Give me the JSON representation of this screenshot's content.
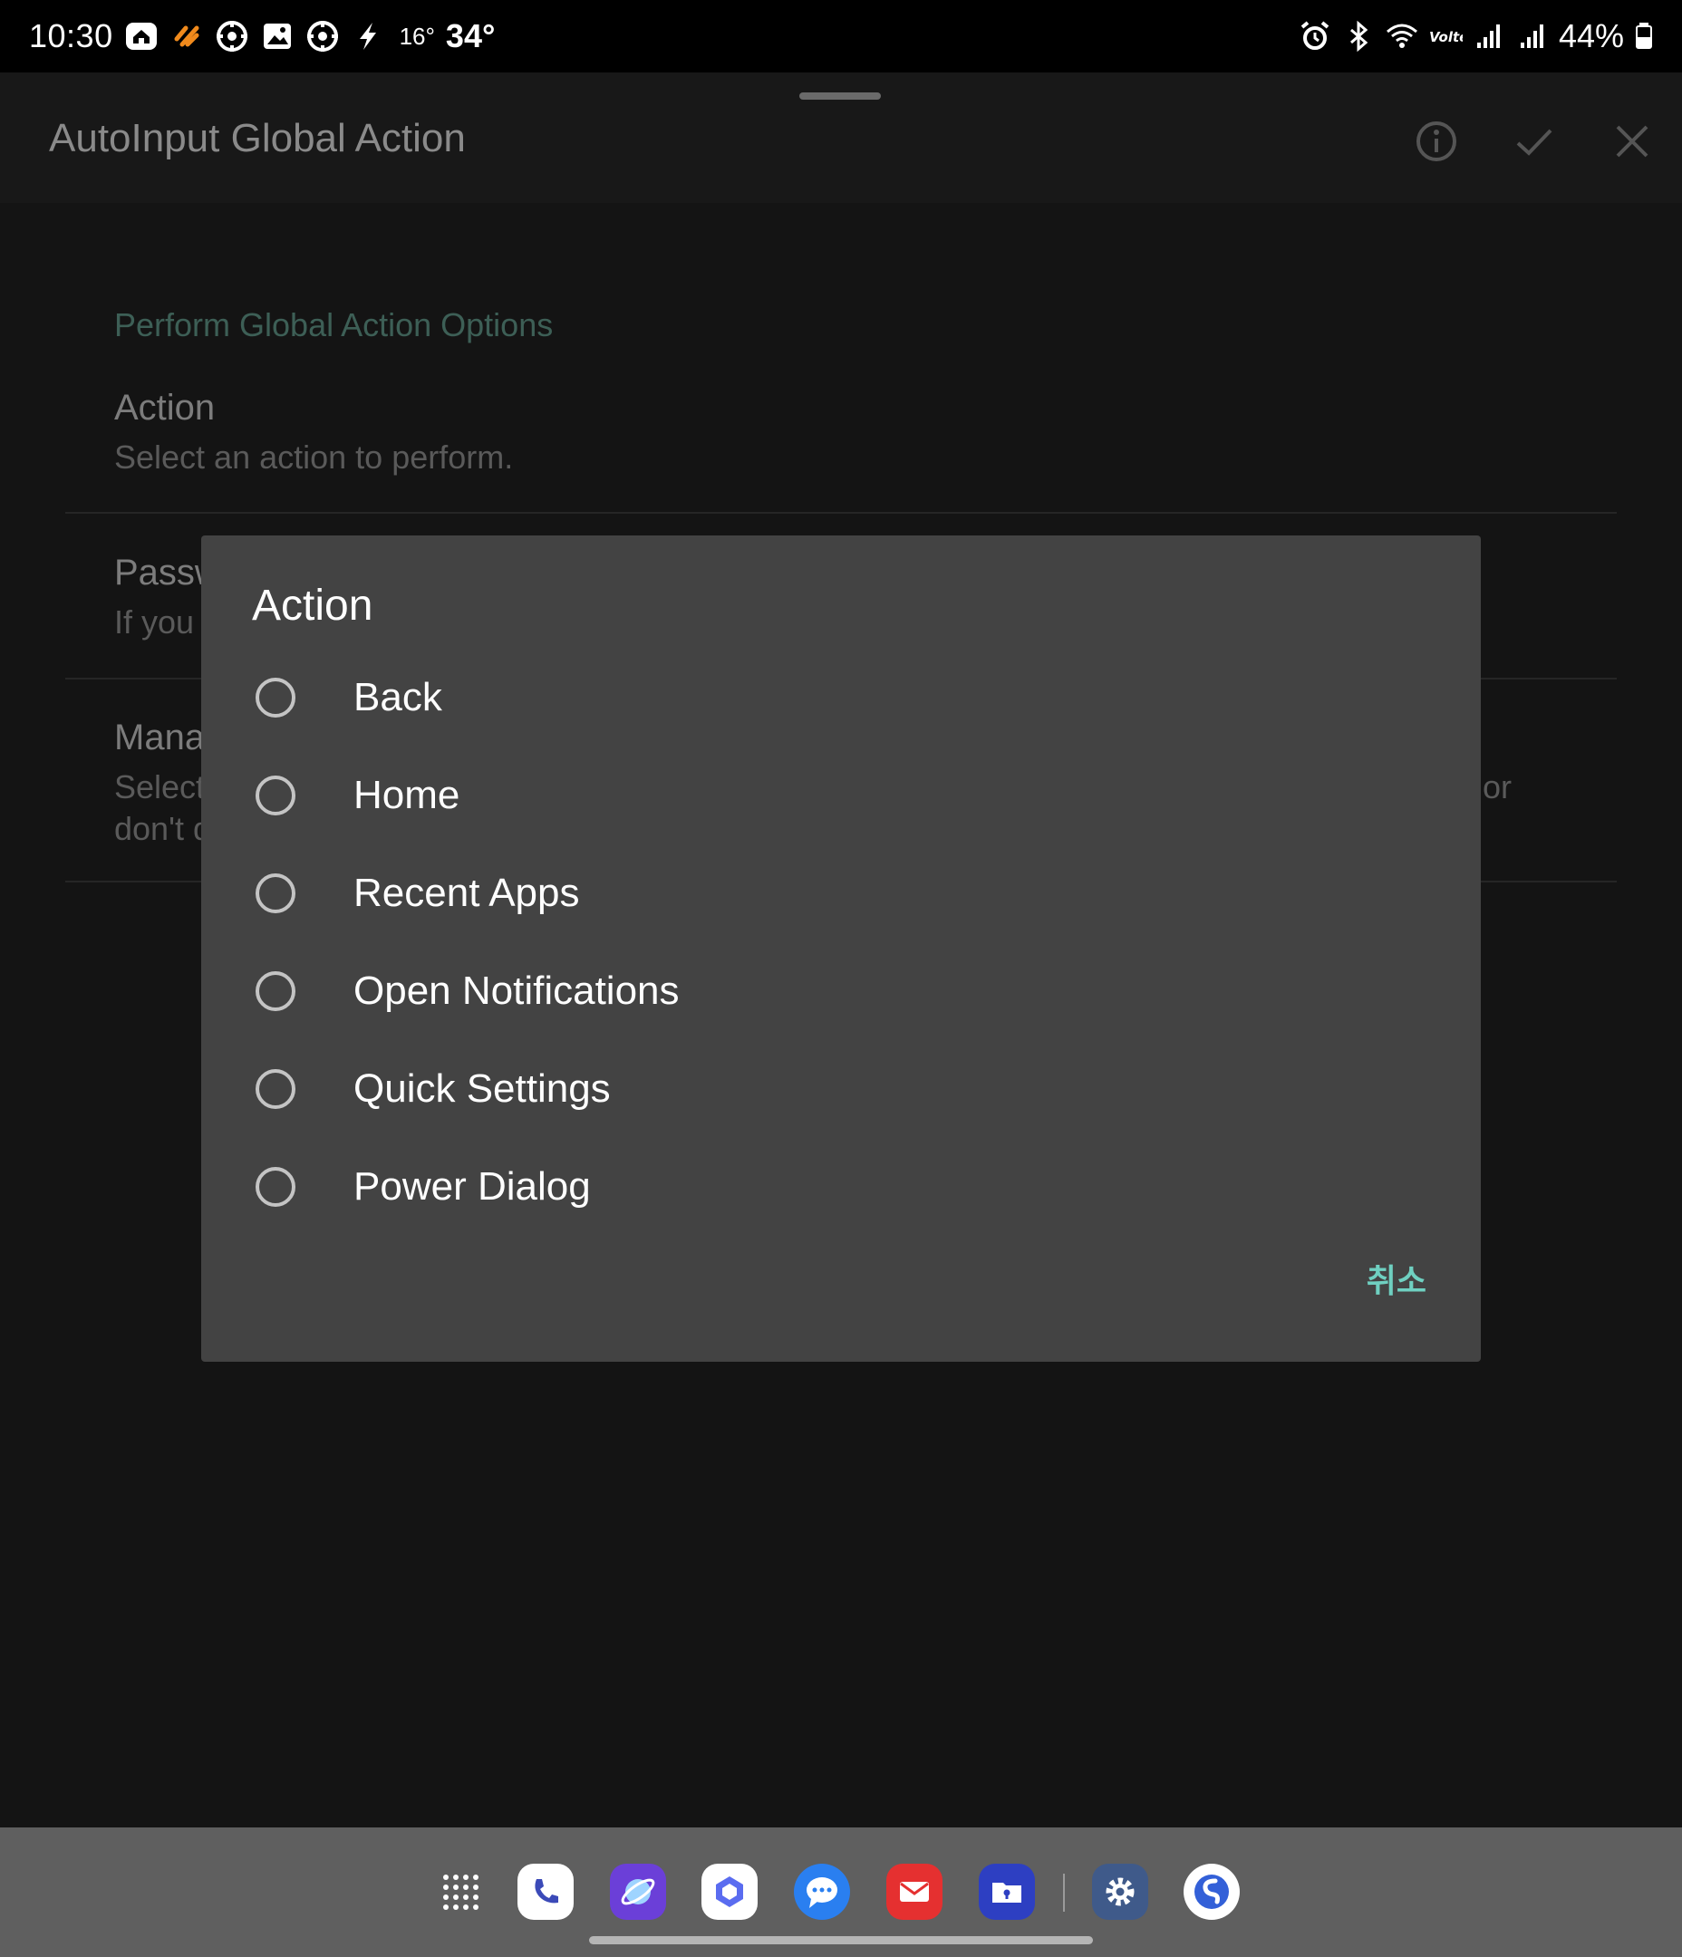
{
  "status_bar": {
    "time": "10:30",
    "temp_small": "16°",
    "temp_big": "34°",
    "battery": "44%",
    "left_icons": [
      "home-app-icon",
      "slash-app-icon",
      "target-app-icon",
      "gallery-icon",
      "target-app-icon",
      "bolt-icon"
    ],
    "right_icons": [
      "alarm-icon",
      "bluetooth-icon",
      "wifi-icon",
      "volte-icon",
      "signal-icon",
      "signal-icon",
      "battery-icon"
    ]
  },
  "app": {
    "title": "AutoInput Global Action",
    "section_header": "Perform Global Action Options",
    "prefs": [
      {
        "title": "Action",
        "summary": "Select an action to perform."
      },
      {
        "title": "Passw",
        "summary": "If you"
      },
      {
        "title": "Mana",
        "summary_line1": "Select",
        "summary_line1_right": "or",
        "summary_line2": "don't d"
      }
    ]
  },
  "dialog": {
    "title": "Action",
    "options": [
      "Back",
      "Home",
      "Recent Apps",
      "Open Notifications",
      "Quick Settings",
      "Power Dialog"
    ],
    "cancel_label": "취소"
  },
  "dock": {
    "apps": [
      "app-drawer-icon",
      "phone-icon",
      "internet-icon",
      "bixby-icon",
      "messages-icon",
      "email-icon",
      "secure-folder-icon",
      "settings-icon",
      "simplenote-icon"
    ]
  },
  "colors": {
    "accent": "#6fd0c1",
    "dialog_bg": "#434343",
    "section_header": "#3d5f56",
    "taskbar_bg": "#5f5f5f"
  }
}
